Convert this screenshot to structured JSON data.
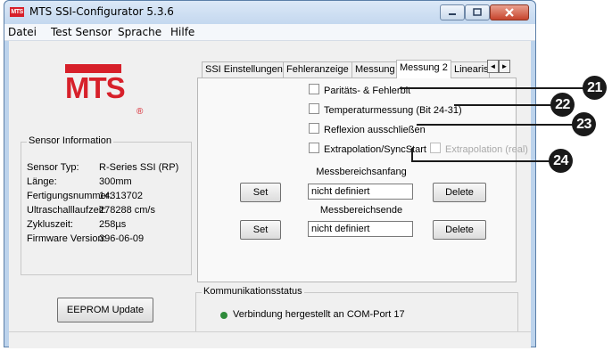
{
  "window": {
    "app_icon_text": "MTS",
    "title": "MTS SSI-Configurator 5.3.6"
  },
  "menu": [
    {
      "label": "Datei"
    },
    {
      "label": "Test Sensor"
    },
    {
      "label": "Sprache"
    },
    {
      "label": "Hilfe"
    }
  ],
  "logo": {
    "text": "MTS",
    "registered": "®"
  },
  "sensor_info": {
    "legend": "Sensor Information",
    "rows": [
      {
        "key": "Sensor Typ:",
        "value": "R-Series SSI (RP)"
      },
      {
        "key": "Länge:",
        "value": "300mm"
      },
      {
        "key": "Fertigungsnummer:",
        "value": "14313702"
      },
      {
        "key": "Ultraschalllaufzeit:",
        "value": "278288 cm/s"
      },
      {
        "key": "Zykluszeit:",
        "value": "258µs"
      },
      {
        "key": "Firmware Version:",
        "value": "396-06-09"
      }
    ]
  },
  "eeprom_button": "EEPROM Update",
  "tabs": [
    {
      "label": "SSI Einstellungen",
      "active": false
    },
    {
      "label": "Fehleranzeige",
      "active": false
    },
    {
      "label": "Messung",
      "active": false
    },
    {
      "label": "Messung 2",
      "active": true
    },
    {
      "label": "Linearis",
      "active": false
    }
  ],
  "tab_scroll": {
    "left": "◄",
    "right": "►"
  },
  "options": {
    "paritaet": "Paritäts- & Fehlerbit",
    "temperatur": "Temperaturmessung (Bit 24-31)",
    "reflexion": "Reflexion ausschließen",
    "extrapolation": "Extrapolation/SyncStart",
    "extrapolation_real": "Extrapolation (real)"
  },
  "messbereich": {
    "anfang_label": "Messbereichsanfang",
    "anfang_value": "nicht definiert",
    "ende_label": "Messbereichsende",
    "ende_value": "nicht definiert",
    "set_label": "Set",
    "delete_label": "Delete"
  },
  "comm": {
    "legend": "Kommunikationsstatus",
    "status": "Verbindung hergestellt an COM-Port 17",
    "status_color": "#2e8b3a"
  },
  "callouts": [
    "21",
    "22",
    "23",
    "24"
  ],
  "colors": {
    "brand_red": "#d7202a",
    "titlebar": "#c4d8ef"
  }
}
